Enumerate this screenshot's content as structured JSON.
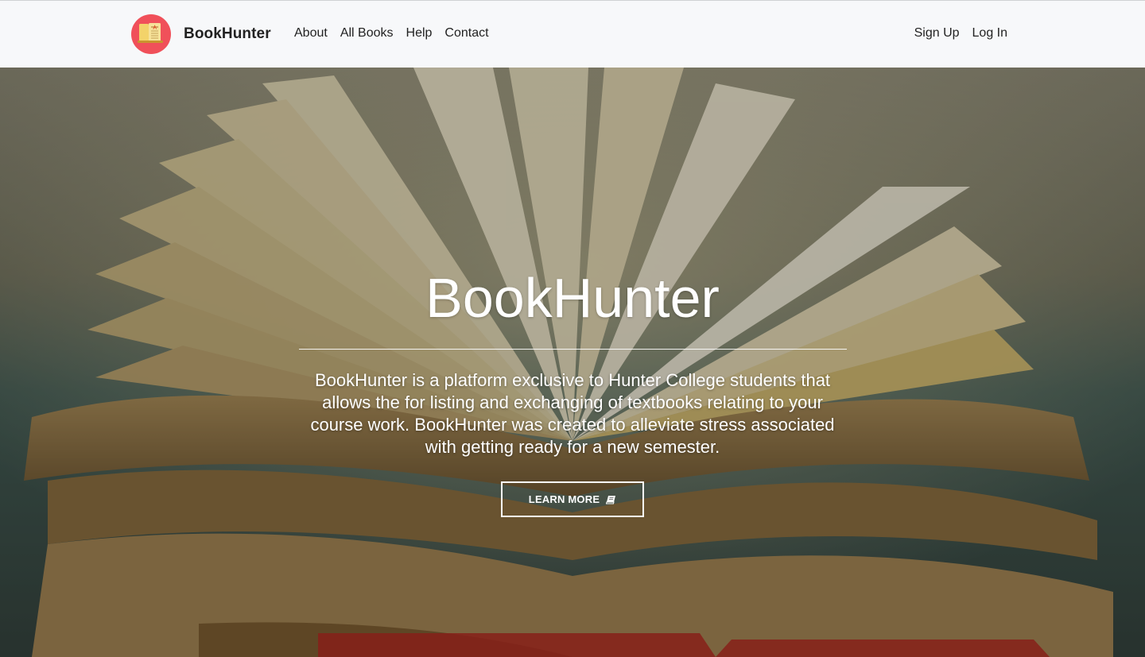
{
  "navbar": {
    "brand": {
      "name": "BookHunter",
      "logo_icon": "book-logo-icon",
      "logo_color": "#f0505a"
    },
    "links": [
      {
        "label": "About"
      },
      {
        "label": "All Books"
      },
      {
        "label": "Help"
      },
      {
        "label": "Contact"
      }
    ],
    "auth": {
      "signup_label": "Sign Up",
      "login_label": "Log In"
    }
  },
  "hero": {
    "background": "open-books-photo",
    "title": "BookHunter",
    "description": "BookHunter is a platform exclusive to Hunter College students that allows the for listing and exchanging of textbooks relating to your course work. BookHunter was created to alleviate stress associated with getting ready for a new semester.",
    "button": {
      "label": "LEARN MORE",
      "icon": "book-icon"
    }
  }
}
